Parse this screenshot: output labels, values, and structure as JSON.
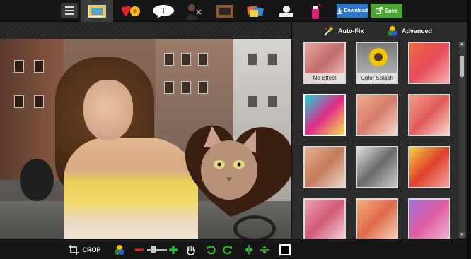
{
  "toolbar": {
    "download_label": "Download",
    "save_label": "Save",
    "text_tool_label": "T"
  },
  "panel": {
    "tabs": [
      {
        "label": "Auto-Fix"
      },
      {
        "label": "Advanced"
      }
    ],
    "effects": [
      {
        "label": "No Effect"
      },
      {
        "label": "Color Splash"
      },
      {
        "label": ""
      },
      {
        "label": ""
      },
      {
        "label": ""
      },
      {
        "label": ""
      },
      {
        "label": ""
      },
      {
        "label": ""
      },
      {
        "label": ""
      },
      {
        "label": ""
      },
      {
        "label": ""
      },
      {
        "label": ""
      }
    ]
  },
  "bottombar": {
    "crop_label": "CROP"
  }
}
